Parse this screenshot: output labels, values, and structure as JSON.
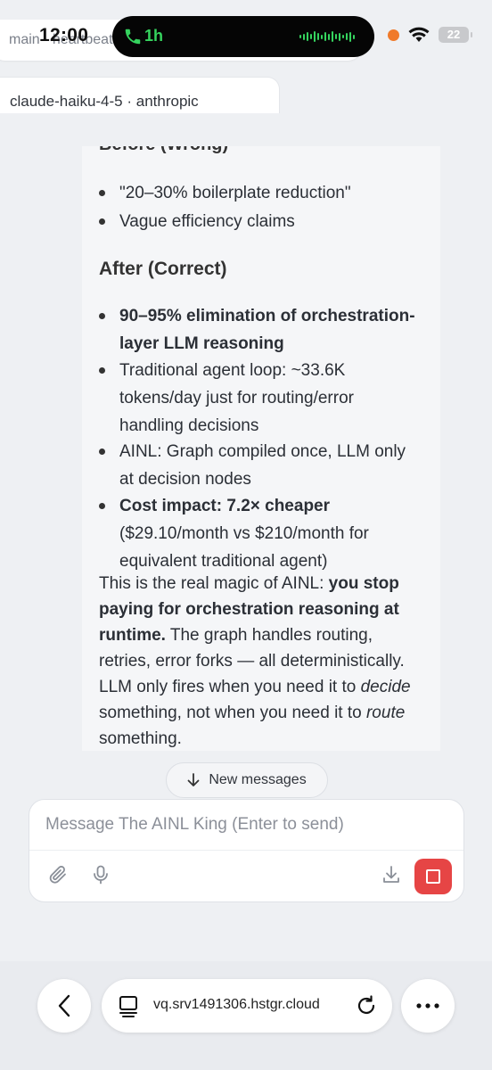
{
  "status_bar": {
    "time": "12:00",
    "call_duration": "1h",
    "battery_level": "22"
  },
  "header": {
    "session_label": "main · heartbeat",
    "model_label": "claude-haiku-4-5 · anthropic"
  },
  "message": {
    "clipped_heading": "Before (Wrong)",
    "before_items": [
      "\"20–30% boilerplate reduction\"",
      "Vague efficiency claims"
    ],
    "after_heading": "After (Correct)",
    "after_items": [
      {
        "bold": "90–95% elimination of orchestration-layer LLM reasoning",
        "text": ""
      },
      {
        "bold": "",
        "text": "Traditional agent loop: ~33.6K tokens/day just for routing/error handling decisions"
      },
      {
        "bold": "",
        "text": "AINL: Graph compiled once, LLM only at decision nodes"
      },
      {
        "bold": "Cost impact: 7.2× cheaper",
        "text": "($29.10/month vs $210/month for equivalent traditional agent)"
      }
    ],
    "closing": {
      "p1": "This is the real magic of AINL: ",
      "b1": "you stop paying for orchestration reasoning at runtime.",
      "p2": " The graph handles routing, retries, error forks — all deterministically. LLM only fires when you need it to ",
      "i1": "decide",
      "p3": " something, not when you need it to ",
      "i2": "route",
      "p4": " something."
    }
  },
  "new_messages_label": "New messages",
  "composer": {
    "placeholder": "Message The AINL King (Enter to send)",
    "value": ""
  },
  "browser": {
    "url": "vq.srv1491306.hstgr.cloud"
  },
  "colors": {
    "accent_red": "#e64545",
    "call_green": "#35d35e",
    "recording_orange": "#f07a2a"
  }
}
